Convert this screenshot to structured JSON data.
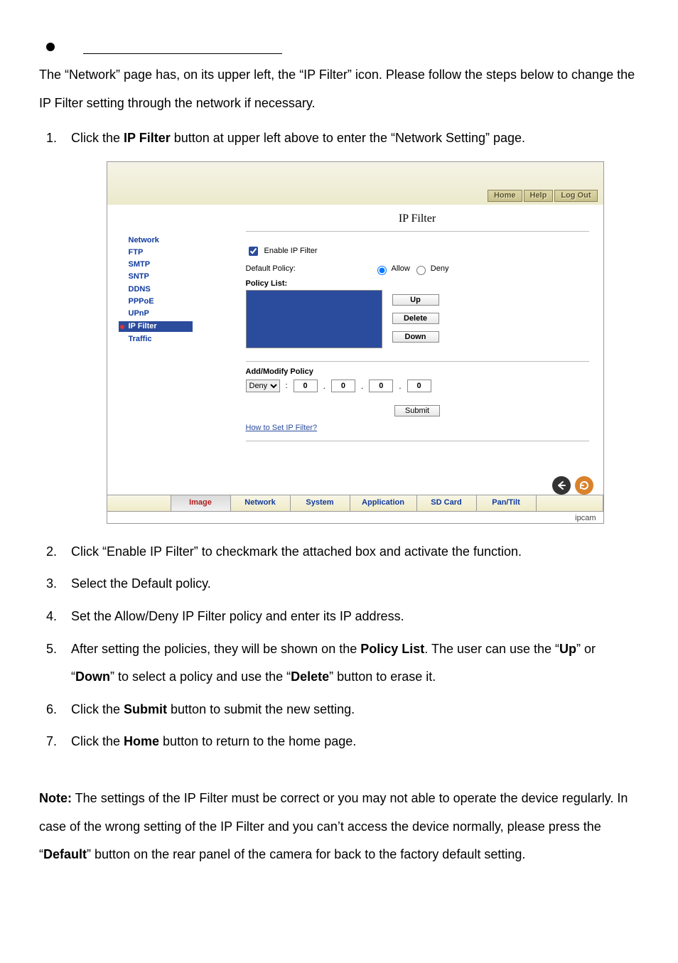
{
  "doc": {
    "intro": "The “Network” page has, on its upper left, the “IP Filter” icon. Please follow the steps below to change the IP Filter setting through the network if necessary.",
    "step1_pre": "Click the ",
    "step1_b": "IP Filter",
    "step1_post": " button at upper left above to enter the “Network Setting” page.",
    "step2": "Click “Enable IP Filter” to checkmark the attached box and activate the function.",
    "step3": "Select the Default policy.",
    "step4": "Set the Allow/Deny IP Filter policy and enter its IP address.",
    "step5_a": "After setting the policies, they will be shown on the ",
    "step5_b1": "Policy List",
    "step5_c": ". The user can use the “",
    "step5_b2": "Up",
    "step5_d": "” or “",
    "step5_b3": "Down",
    "step5_e": "” to select a policy and use the “",
    "step5_b4": "Delete",
    "step5_f": "” button to erase it.",
    "step6_a": "Click the ",
    "step6_b": "Submit",
    "step6_c": " button to submit the new setting.",
    "step7_a": "Click the ",
    "step7_b": "Home",
    "step7_c": " button to return to the home page.",
    "note_lbl": "Note:",
    "note_a": " The settings of the IP Filter must be correct or you may not able to operate the device regularly. In case of the wrong setting of the IP Filter and you can’t access the device normally, please press the “",
    "note_b": "Default",
    "note_c": "” button on the rear panel of the camera for back to the factory default setting."
  },
  "shot": {
    "toplinks": {
      "home": "Home",
      "help": "Help",
      "logout": "Log Out"
    },
    "title": "IP Filter",
    "sidebar": [
      {
        "label": "Network",
        "active": false
      },
      {
        "label": "FTP",
        "active": false
      },
      {
        "label": "SMTP",
        "active": false
      },
      {
        "label": "SNTP",
        "active": false
      },
      {
        "label": "DDNS",
        "active": false
      },
      {
        "label": "PPPoE",
        "active": false
      },
      {
        "label": "UPnP",
        "active": false
      },
      {
        "label": "IP Filter",
        "active": true
      },
      {
        "label": "Traffic",
        "active": false
      }
    ],
    "enable_label": "Enable IP Filter",
    "enable_checked": true,
    "default_policy_label": "Default Policy:",
    "allow_label": "Allow",
    "deny_label": "Deny",
    "default_policy_value": "Allow",
    "policy_list_label": "Policy List:",
    "btn_up": "Up",
    "btn_delete": "Delete",
    "btn_down": "Down",
    "addmod_label": "Add/Modify Policy",
    "addmod_action": "Deny",
    "ip_octets": [
      "0",
      "0",
      "0",
      "0"
    ],
    "submit_label": "Submit",
    "howto_label": "How to Set IP Filter?",
    "tabs": [
      "Image",
      "Network",
      "System",
      "Application",
      "SD Card",
      "Pan/Tilt"
    ],
    "brand": "ipcam"
  }
}
